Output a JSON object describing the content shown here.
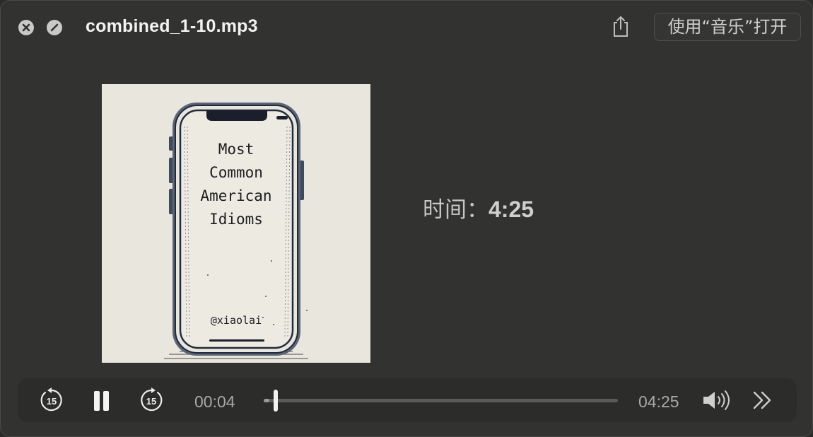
{
  "window": {
    "title": "combined_1-10.mp3",
    "open_button_label": "使用“音乐”打开"
  },
  "icons": {
    "close": "close-icon",
    "disable": "disable-icon",
    "share": "share-icon",
    "skip_back": "skip-back-15-icon",
    "pause": "pause-icon",
    "skip_forward": "skip-forward-15-icon",
    "volume": "volume-icon",
    "more": "chevron-double-right-icon"
  },
  "artwork": {
    "lines": [
      "Most",
      "Common",
      "American",
      "Idioms"
    ],
    "handle": "@xiaolai"
  },
  "info": {
    "duration_label": "时间：",
    "duration_value": "4:25"
  },
  "player": {
    "skip_seconds": "15",
    "current_time": "00:04",
    "total_time": "04:25",
    "progress": 0.015
  },
  "colors": {
    "window_bg": "#323231",
    "controls_bg": "#2c2c2b",
    "text_primary": "#f2f2f2",
    "text_secondary": "#a9a9a7"
  }
}
